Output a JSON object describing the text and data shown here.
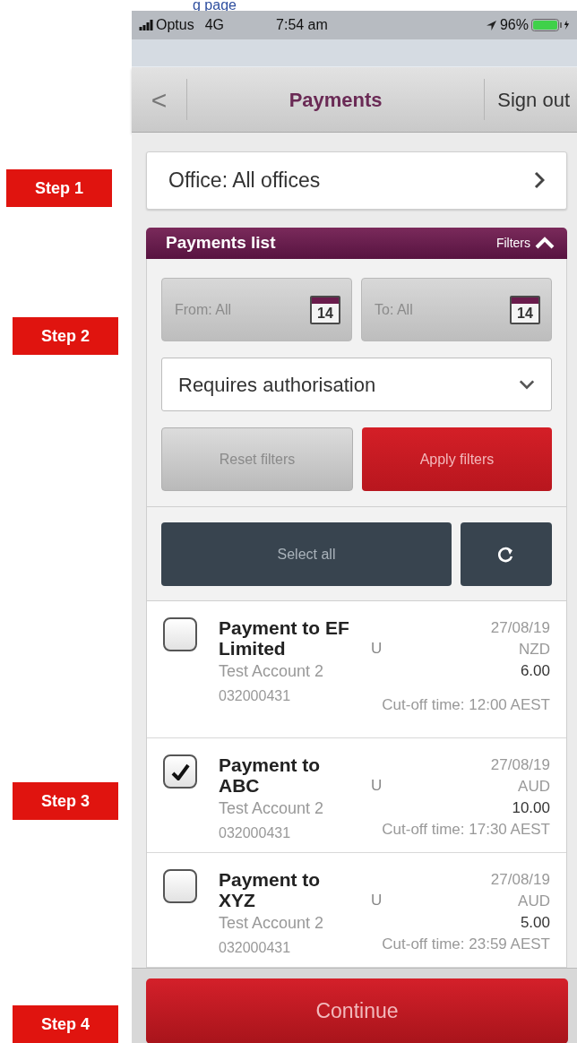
{
  "caption": "g page",
  "annotations": [
    {
      "label": "Step 1",
      "kind": "step1"
    },
    {
      "label": "Step 2",
      "kind": "step2"
    },
    {
      "label": "Step 3",
      "kind": "step3"
    },
    {
      "label": "Step 4",
      "kind": "step4"
    }
  ],
  "status_bar": {
    "carrier": "Optus",
    "network": "4G",
    "time": "7:54 am",
    "battery": "96%"
  },
  "nav_bar": {
    "back": "<",
    "title": "Payments",
    "sign_out": "Sign out"
  },
  "office_selector": {
    "label": "Office: All offices"
  },
  "payments_list": {
    "title": "Payments list",
    "filters_toggle": "Filters",
    "expanded": true
  },
  "filters": {
    "from": "From: All",
    "to": "To: All",
    "from_day": "14",
    "to_day": "14",
    "status": "Requires authorisation",
    "reset": "Reset filters",
    "apply": "Apply filters"
  },
  "select_all": "Select all",
  "payments": [
    {
      "name": "Payment to EF Limited",
      "flag": "U",
      "account": "Test Account 2",
      "number": "032000431",
      "date": "27/08/19",
      "currency": "NZD",
      "amount": "6.00",
      "cutoff": "Cut-off time: 12:00 AEST",
      "checked": false
    },
    {
      "name": "Payment to ABC",
      "flag": "U",
      "account": "Test Account 2",
      "number": "032000431",
      "date": "27/08/19",
      "currency": "AUD",
      "amount": "10.00",
      "cutoff": "Cut-off time: 17:30 AEST",
      "checked": true
    },
    {
      "name": "Payment to XYZ",
      "flag": "U",
      "account": "Test Account 2",
      "number": "032000431",
      "date": "27/08/19",
      "currency": "AUD",
      "amount": "5.00",
      "cutoff": "Cut-off time: 23:59 AEST",
      "checked": false
    }
  ],
  "continue_button": "Continue"
}
